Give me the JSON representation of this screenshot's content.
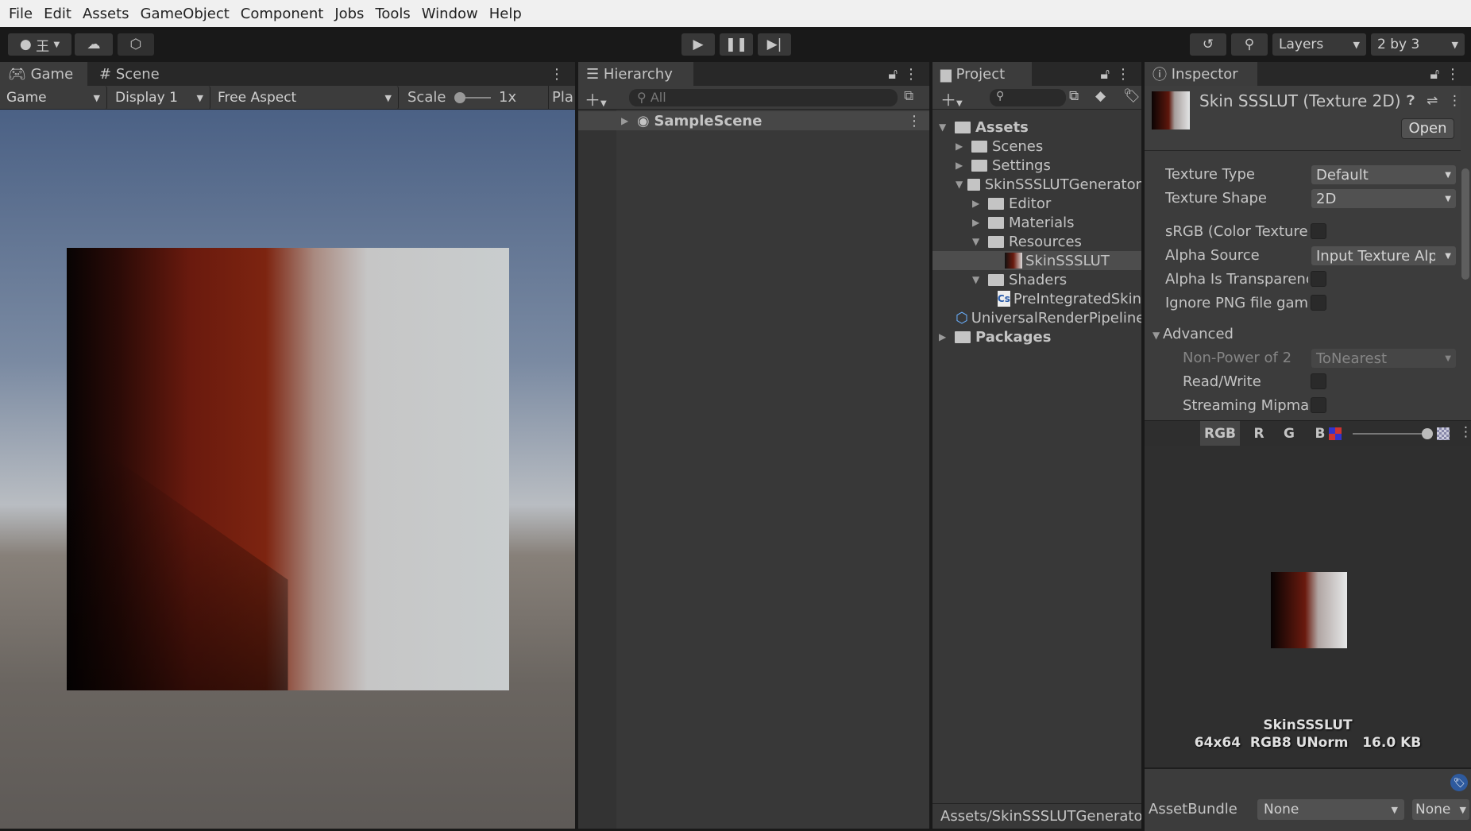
{
  "menu": [
    "File",
    "Edit",
    "Assets",
    "GameObject",
    "Component",
    "Jobs",
    "Tools",
    "Window",
    "Help"
  ],
  "toolbar": {
    "account_label": "王",
    "layers": "Layers",
    "layout": "2 by 3"
  },
  "game": {
    "tabs": [
      "Game",
      "Scene"
    ],
    "mode": "Game",
    "display": "Display 1",
    "aspect": "Free Aspect",
    "scale_label": "Scale",
    "scale_value": "1x",
    "play_focus": "Pla"
  },
  "hierarchy": {
    "tab": "Hierarchy",
    "search_placeholder": "All",
    "scene": "SampleScene"
  },
  "project": {
    "tab": "Project",
    "tree": [
      {
        "label": "Assets",
        "depth": 0,
        "state": "open",
        "bold": true
      },
      {
        "label": "Scenes",
        "depth": 1,
        "state": "closed"
      },
      {
        "label": "Settings",
        "depth": 1,
        "state": "closed"
      },
      {
        "label": "SkinSSSLUTGenerator",
        "depth": 1,
        "state": "open"
      },
      {
        "label": "Editor",
        "depth": 2,
        "state": "closed"
      },
      {
        "label": "Materials",
        "depth": 2,
        "state": "closed"
      },
      {
        "label": "Resources",
        "depth": 2,
        "state": "open"
      },
      {
        "label": "SkinSSSLUT",
        "depth": 3,
        "state": "texture",
        "selected": true
      },
      {
        "label": "Shaders",
        "depth": 2,
        "state": "open"
      },
      {
        "label": "PreIntegratedSkin",
        "depth": 3,
        "state": "script"
      },
      {
        "label": "UniversalRenderPipeline",
        "depth": 1,
        "state": "asset"
      },
      {
        "label": "Packages",
        "depth": 0,
        "state": "closed",
        "bold": true
      }
    ],
    "footer_path": "Assets/SkinSSSLUTGenerator"
  },
  "inspector": {
    "tab": "Inspector",
    "title": "Skin SSSLUT (Texture 2D)",
    "open_button": "Open",
    "props": {
      "texture_type": {
        "label": "Texture Type",
        "value": "Default"
      },
      "texture_shape": {
        "label": "Texture Shape",
        "value": "2D"
      },
      "srgb": {
        "label": "sRGB (Color Texture)",
        "checked": false
      },
      "alpha_source": {
        "label": "Alpha Source",
        "value": "Input Texture Alpha"
      },
      "alpha_transparency": {
        "label": "Alpha Is Transparency",
        "checked": false
      },
      "ignore_png": {
        "label": "Ignore PNG file gamma",
        "checked": false
      },
      "advanced": "Advanced",
      "npot": {
        "label": "Non-Power of 2",
        "value": "ToNearest"
      },
      "read_write": {
        "label": "Read/Write",
        "checked": false
      },
      "streaming": {
        "label": "Streaming Mipmaps",
        "checked": false
      }
    },
    "preview": {
      "channels": [
        "RGB",
        "R",
        "G",
        "B"
      ],
      "name": "SkinSSSLUT",
      "info": "64x64  RGB8 UNorm   16.0 KB"
    },
    "assetbundle": {
      "label": "AssetBundle",
      "value": "None",
      "variant": "None"
    }
  },
  "colors": {
    "accent_tag": "#2e5a9e",
    "selection": "#4d4d4d"
  }
}
